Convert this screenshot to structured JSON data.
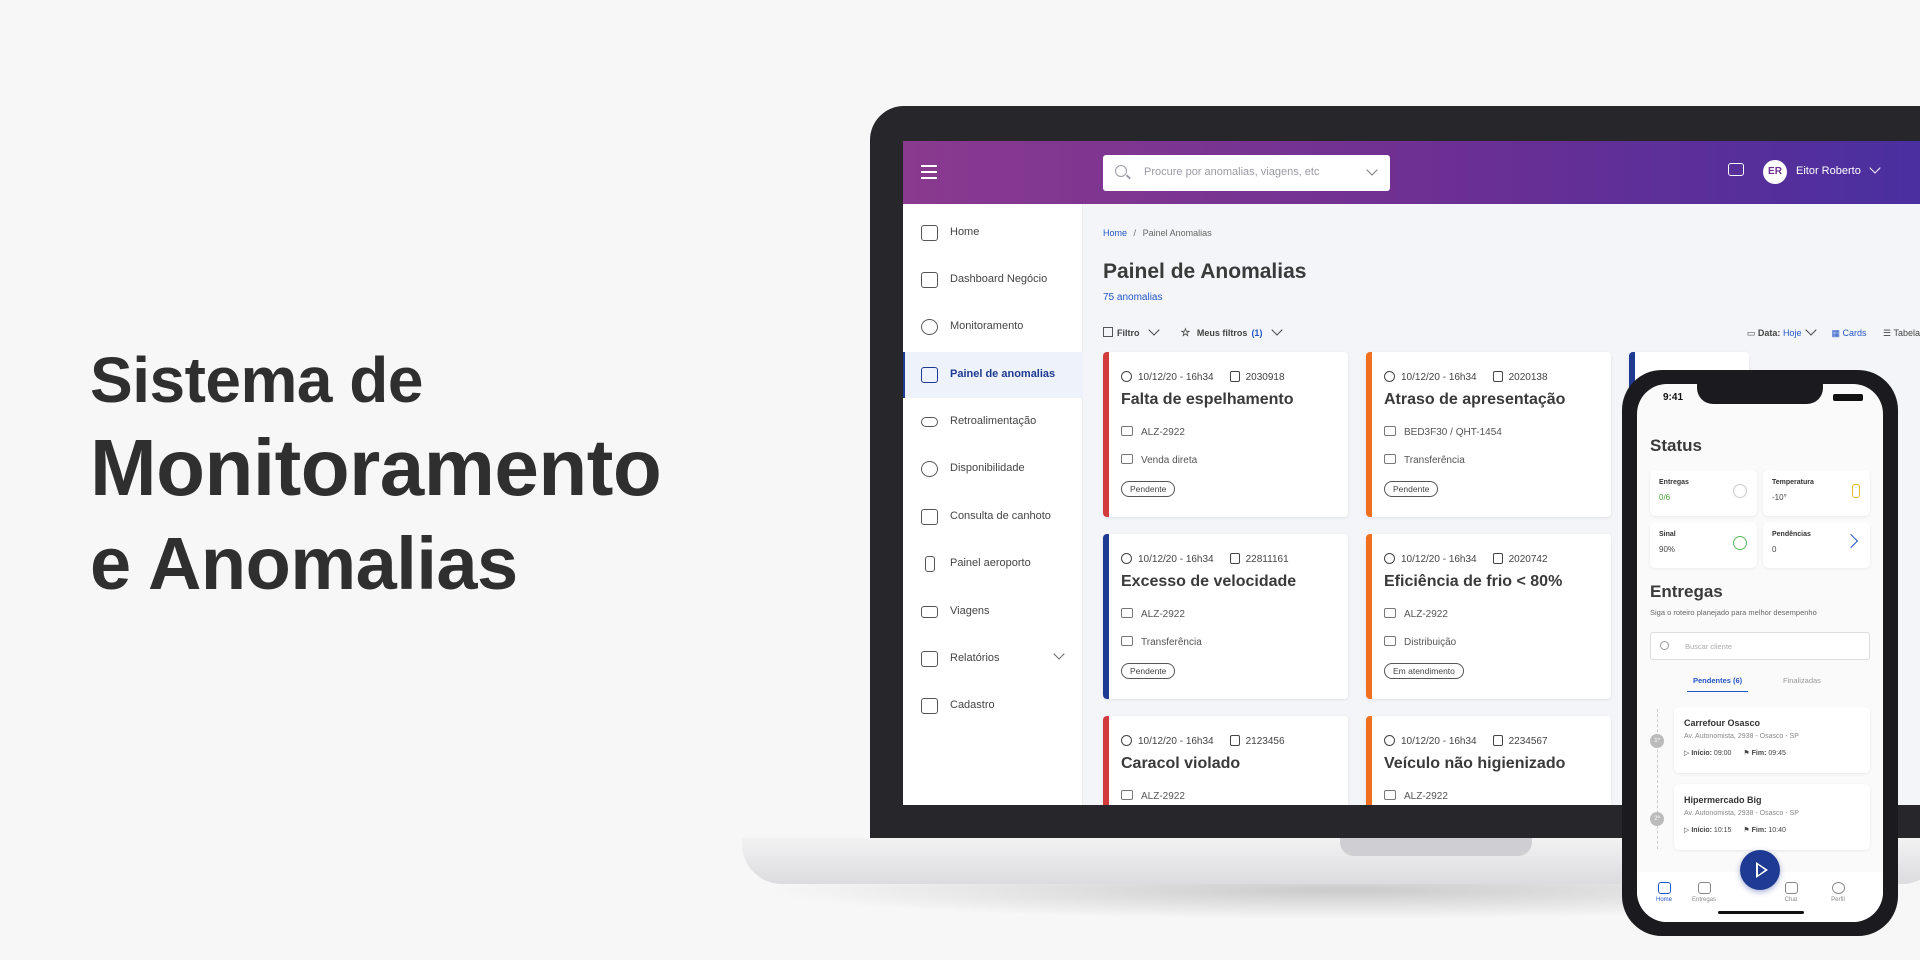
{
  "hero": {
    "line1": "Sistema de",
    "line2": "Monitoramento",
    "line3": "e Anomalias"
  },
  "topbar": {
    "search_placeholder": "Procure por anomalias, viagens, etc",
    "avatar_initials": "ER",
    "user_name": "Eitor Roberto"
  },
  "sidebar": {
    "items": [
      {
        "label": "Home",
        "icon": "home-icon"
      },
      {
        "label": "Dashboard Negócio",
        "icon": "dashboard-icon"
      },
      {
        "label": "Monitoramento",
        "icon": "gauge-icon"
      },
      {
        "label": "Painel de anomalias",
        "icon": "warning-icon",
        "active": true
      },
      {
        "label": "Retroalimentação",
        "icon": "infinity-icon"
      },
      {
        "label": "Disponibilidade",
        "icon": "availability-icon"
      },
      {
        "label": "Consulta de canhoto",
        "icon": "calendar-icon"
      },
      {
        "label": "Painel aeroporto",
        "icon": "tower-icon"
      },
      {
        "label": "Viagens",
        "icon": "truck-icon"
      },
      {
        "label": "Relatórios",
        "icon": "report-icon"
      },
      {
        "label": "Cadastro",
        "icon": "register-icon"
      }
    ]
  },
  "breadcrumb": {
    "home": "Home",
    "separator": "/",
    "current": "Painel Anomalias"
  },
  "page": {
    "title": "Painel de Anomalias",
    "count": "75 anomalias"
  },
  "filters": {
    "filter_label": "Filtro",
    "my_filters_label": "Meus filtros",
    "my_filters_count": "(1)",
    "date_label": "Data:",
    "date_value": "Hoje",
    "view_cards": "Cards",
    "view_table": "Tabela"
  },
  "cards": [
    {
      "datetime": "10/12/20 - 16h34",
      "id": "2030918",
      "title": "Falta de espelhamento",
      "vehicle": "ALZ-2922",
      "type": "Venda direta",
      "status": "Pendente",
      "color": "#d23b3b"
    },
    {
      "datetime": "10/12/20 - 16h34",
      "id": "2020138",
      "title": "Atraso de apresentação",
      "vehicle": "BED3F30 / QHT-1454",
      "type": "Transferência",
      "status": "Pendente",
      "color": "#f07020"
    },
    {
      "datetime": "10/12/20 - 16h34",
      "id": "22811161",
      "title": "Excesso de velocidade",
      "vehicle": "ALZ-2922",
      "type": "Transferência",
      "status": "Pendente",
      "color": "#1f3a93"
    },
    {
      "datetime": "10/12/20 - 16h34",
      "id": "2020742",
      "title": "Eficiência de frio < 80%",
      "vehicle": "ALZ-2922",
      "type": "Distribuição",
      "status": "Em atendimento",
      "color": "#f07020"
    },
    {
      "datetime": "10/12/20 - 16h34",
      "id": "2123456",
      "title": "Caracol violado",
      "vehicle": "ALZ-2922",
      "color": "#d23b3b"
    },
    {
      "datetime": "10/12/20 - 16h34",
      "id": "2234567",
      "title": "Veículo não higienizado",
      "vehicle": "ALZ-2922",
      "color": "#f07020"
    }
  ],
  "phone": {
    "time": "9:41",
    "status_title": "Status",
    "tiles": [
      {
        "label": "Entregas",
        "value": "0/6"
      },
      {
        "label": "Temperatura",
        "value": "-10°"
      },
      {
        "label": "Sinal",
        "value": "90%"
      },
      {
        "label": "Pendências",
        "value": "0"
      }
    ],
    "deliveries_title": "Entregas",
    "deliveries_sub": "Siga o roteiro planejado para melhor desempenho",
    "search_placeholder": "Buscar cliente",
    "tab_pending": "Pendentes (6)",
    "tab_done": "Finalizadas",
    "stops": [
      {
        "num": "1º",
        "name": "Carrefour Osasco",
        "address": "Av. Autonomista, 2938 - Osasco - SP",
        "start_label": "Início:",
        "start": "09:00",
        "end_label": "Fim:",
        "end": "09:45"
      },
      {
        "num": "2º",
        "name": "Hipermercado Big",
        "address": "Av. Autonomista, 2938 - Osasco - SP",
        "start_label": "Início:",
        "start": "10:15",
        "end_label": "Fim:",
        "end": "10:40"
      }
    ],
    "nav": [
      {
        "label": "Home"
      },
      {
        "label": "Entregas"
      },
      {
        "label": "Chat"
      },
      {
        "label": "Perfil"
      }
    ]
  }
}
